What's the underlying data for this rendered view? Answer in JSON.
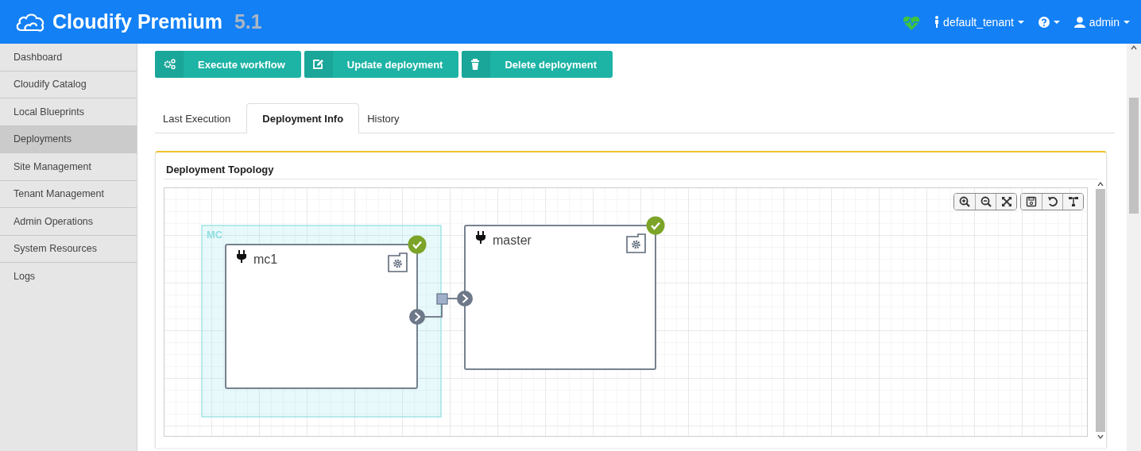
{
  "header": {
    "product": "Cloudify Premium",
    "version": "5.1",
    "healthy": true,
    "tenant": "default_tenant",
    "user": "admin"
  },
  "sidebar": {
    "items": [
      {
        "label": "Dashboard",
        "selected": false
      },
      {
        "label": "Cloudify Catalog",
        "selected": false
      },
      {
        "label": "Local Blueprints",
        "selected": false
      },
      {
        "label": "Deployments",
        "selected": true
      },
      {
        "label": "Site Management",
        "selected": false
      },
      {
        "label": "Tenant Management",
        "selected": false
      },
      {
        "label": "Admin Operations",
        "selected": false
      },
      {
        "label": "System Resources",
        "selected": false
      },
      {
        "label": "Logs",
        "selected": false
      }
    ]
  },
  "actions": [
    {
      "label": "Execute workflow",
      "kind": "workflow"
    },
    {
      "label": "Update deployment",
      "kind": "edit"
    },
    {
      "label": "Delete deployment",
      "kind": "delete"
    }
  ],
  "tabs": [
    {
      "label": "Last Execution",
      "selected": false
    },
    {
      "label": "Deployment Info",
      "selected": true
    },
    {
      "label": "History",
      "selected": false
    }
  ],
  "panel": {
    "title": "Deployment Topology",
    "topology": {
      "groups": [
        {
          "label": "MC"
        }
      ],
      "nodes": [
        {
          "name": "mc1",
          "installed": true
        },
        {
          "name": "master",
          "installed": true
        }
      ]
    }
  }
}
